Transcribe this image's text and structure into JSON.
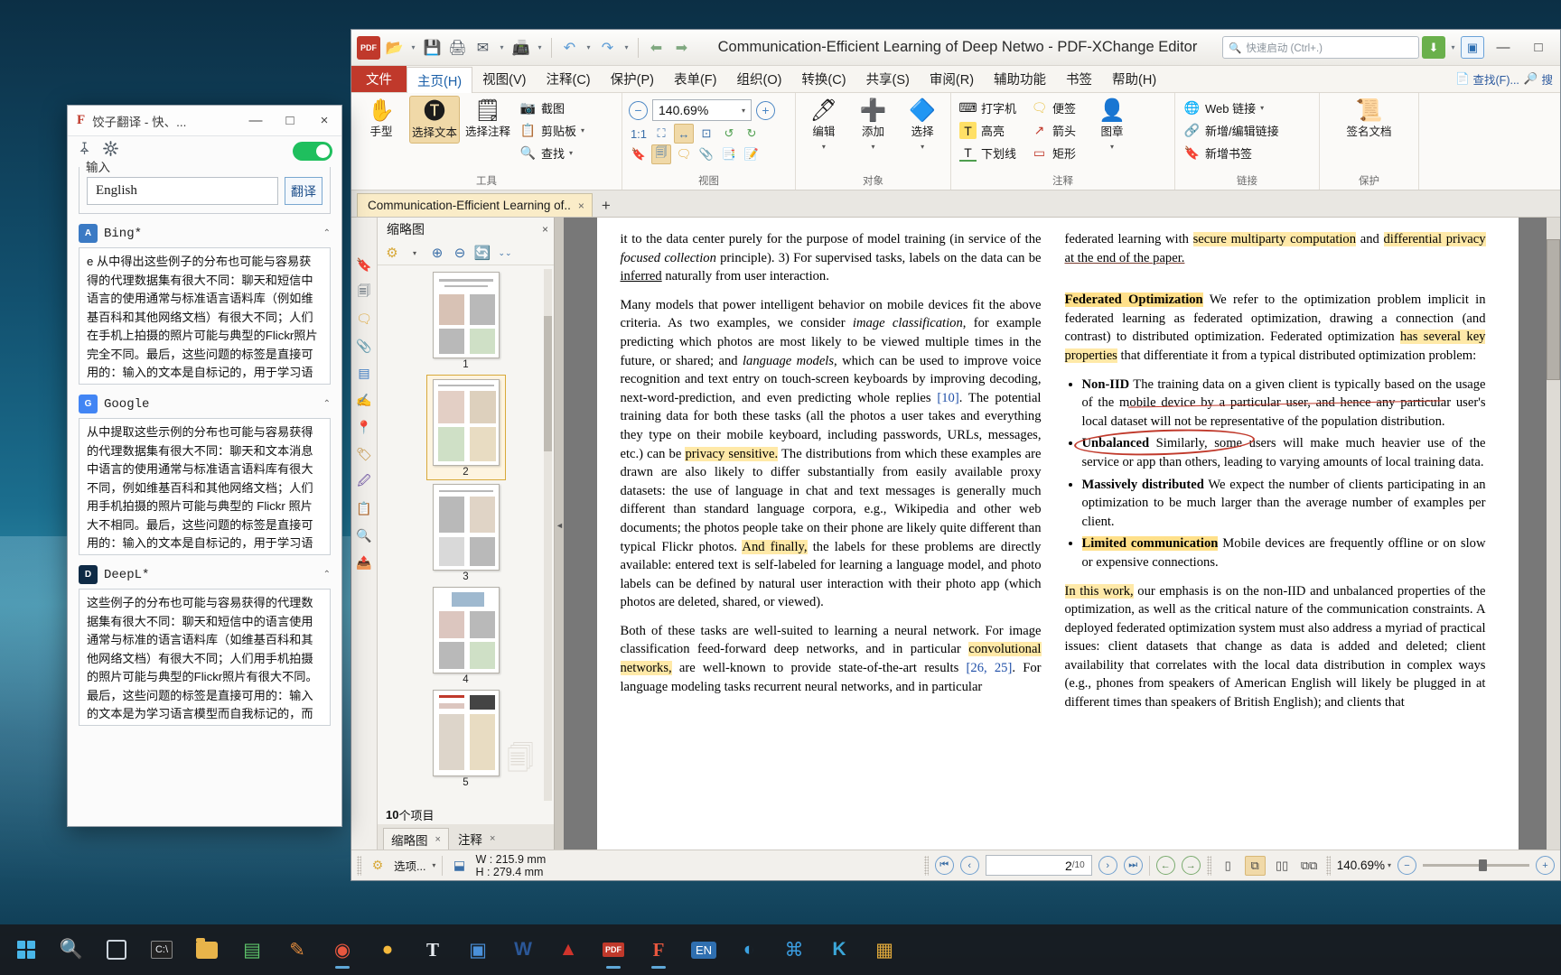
{
  "translator": {
    "logo": "F",
    "title": "饺子翻译 - 快、...",
    "win_minimize": "—",
    "win_maximize": "□",
    "win_close": "×",
    "pin_icon": "📌",
    "gear_icon": "⚙",
    "input_legend": "输入",
    "input_value": "English",
    "translate_button": "翻译",
    "providers": [
      {
        "badge": "A",
        "name": "Bing*",
        "text": "e 从中得出这些例子的分布也可能与容易获得的代理数据集有很大不同：聊天和短信中语言的使用通常与标准语言语料库（例如维基百科和其他网络文档）有很大不同；人们在手机上拍摄的照片可能与典型的Flickr照片完全不同。最后，这些问题的标签是直接可用的：输入的文本是自标记的，用于学习语言模型，照片标签可以通过自然用户与其照片应用程序的交互来定义。"
      },
      {
        "badge": "G",
        "name": "Google",
        "text": "从中提取这些示例的分布也可能与容易获得的代理数据集有很大不同：聊天和文本消息中语言的使用通常与标准语言语料库有很大不同，例如维基百科和其他网络文档；人们用手机拍摄的照片可能与典型的 Flickr 照片大不相同。最后，这些问题的标签是直接可用的：输入的文本是自标记的，用于学习语言模型，照片标签可以通过用户与其照片应用程序的自然交互（哪些照"
      },
      {
        "badge": "D",
        "name": "DeepL*",
        "text": "这些例子的分布也可能与容易获得的代理数据集有很大不同：聊天和短信中的语言使用通常与标准的语言语料库（如维基百科和其他网络文档）有很大不同；人们用手机拍摄的照片可能与典型的Flickr照片有很大不同。最后，这些问题的标签是直接可用的：输入的文本是为学习语言模型而自我标记的，而照片的标签可以通过用户与他们的照片应用程序的自然互动（哪些照"
      }
    ]
  },
  "pdf": {
    "app_title": "Communication-Efficient Learning of Deep Netwo - PDF-XChange Editor",
    "quick_access": {
      "logo_label": "PDF",
      "icons": [
        "open-icon",
        "save-icon",
        "print-icon",
        "email-icon",
        "scan-icon",
        "undo-icon",
        "redo-icon",
        "back-icon",
        "forward-icon"
      ]
    },
    "search_placeholder": "快速启动 (Ctrl+.)",
    "window_buttons": {
      "minimize": "—",
      "maximize": "□",
      "close": "×"
    },
    "menu": {
      "file": "文件",
      "items": [
        {
          "label": "主页(H)",
          "active": true
        },
        {
          "label": "视图(V)",
          "active": false
        },
        {
          "label": "注释(C)",
          "active": false
        },
        {
          "label": "保护(P)",
          "active": false
        },
        {
          "label": "表单(F)",
          "active": false
        },
        {
          "label": "组织(O)",
          "active": false
        },
        {
          "label": "转换(C)",
          "active": false
        },
        {
          "label": "共享(S)",
          "active": false
        },
        {
          "label": "审阅(R)",
          "active": false
        },
        {
          "label": "辅助功能",
          "active": false
        },
        {
          "label": "书签",
          "active": false
        },
        {
          "label": "帮助(H)",
          "active": false
        }
      ],
      "right_items": [
        {
          "label": "查找(F)...",
          "icon": "find-icon"
        },
        {
          "label": "搜",
          "icon": "search-icon"
        }
      ]
    },
    "ribbon": {
      "groups": [
        {
          "name": "工具",
          "big_buttons": [
            {
              "label": "手型",
              "icon": "hand-icon",
              "selected": false
            },
            {
              "label": "选择文本",
              "icon": "select-text-icon",
              "selected": true
            },
            {
              "label": "选择注释",
              "icon": "select-annotation-icon",
              "selected": false
            }
          ],
          "small_buttons": [
            {
              "label": "截图",
              "icon": "snapshot-icon",
              "caret": false
            },
            {
              "label": "剪贴板",
              "icon": "clipboard-icon",
              "caret": true
            },
            {
              "label": "查找",
              "icon": "find-icon",
              "caret": true
            }
          ]
        },
        {
          "name": "视图",
          "zoom_value": "140.69%",
          "zoom_out": "−",
          "zoom_in": "+",
          "icons_row1": [
            "actual-size-icon",
            "fit-page-icon",
            "fit-width-icon",
            "fit-visible-icon",
            "rotate-left-icon",
            "rotate-right-icon"
          ],
          "icons_row2": [
            "bookmark-pane-icon",
            "thumbnail-pane-icon",
            "comments-pane-icon",
            "attachments-pane-icon",
            "content-pane-icon",
            "properties-icon"
          ]
        },
        {
          "name": "对象",
          "big_buttons": [
            {
              "label": "编辑",
              "icon": "edit-content-icon",
              "caret": true
            },
            {
              "label": "添加",
              "icon": "add-content-icon",
              "caret": true
            },
            {
              "label": "选择",
              "icon": "select-object-icon",
              "caret": true
            }
          ]
        },
        {
          "name": "注释",
          "small_buttons": [
            {
              "label": "打字机",
              "icon": "typewriter-icon"
            },
            {
              "label": "便签",
              "icon": "sticky-note-icon"
            },
            {
              "label": "高亮",
              "icon": "highlight-icon"
            },
            {
              "label": "箭头",
              "icon": "arrow-icon"
            },
            {
              "label": "下划线",
              "icon": "underline-icon"
            },
            {
              "label": "矩形",
              "icon": "rectangle-icon"
            }
          ],
          "stamp": {
            "label": "图章",
            "icon": "stamp-icon",
            "caret": true
          }
        },
        {
          "name": "链接",
          "small_buttons": [
            {
              "label": "Web 链接",
              "icon": "web-link-icon",
              "caret": true
            },
            {
              "label": "新增/编辑链接",
              "icon": "edit-link-icon",
              "caret": false
            },
            {
              "label": "新增书签",
              "icon": "add-bookmark-icon",
              "caret": false
            }
          ]
        },
        {
          "name": "保护",
          "big_buttons": [
            {
              "label": "签名文档",
              "icon": "sign-document-icon"
            }
          ]
        }
      ]
    },
    "doc_tab": {
      "label": "Communication-Efficient Learning of..",
      "close": "×",
      "new_tab": "+"
    },
    "thumbnails": {
      "title": "缩略图",
      "collapse": "×",
      "tool_icons": [
        "settings-icon",
        "caret-down-icon",
        "zoom-in-icon",
        "zoom-out-icon",
        "rotate-icon",
        "more-icon"
      ],
      "pages": [
        {
          "number": "1",
          "current": false
        },
        {
          "number": "2",
          "current": true
        },
        {
          "number": "3",
          "current": false
        },
        {
          "number": "4",
          "current": false
        },
        {
          "number": "5",
          "current": false
        }
      ],
      "item_count_bold": "10",
      "item_count_text": " 个项目",
      "tabs": [
        {
          "label": "缩略图",
          "active": true,
          "close": "×"
        },
        {
          "label": "注释",
          "active": false,
          "close": "×"
        }
      ]
    },
    "document": {
      "left_column": {
        "p1": "it to the data center purely for the purpose of model training (in service of the ",
        "p1_ital": "focused collection",
        "p1_b": " principle). 3) For supervised tasks, labels on the data can be ",
        "p1_udl": "inferred",
        "p1_c": " naturally from user interaction.",
        "p2_a": "Many models that power intelligent behavior on mobile devices fit the above criteria. As two examples, we consider ",
        "p2_ital1": "image classification",
        "p2_b": ", for example predicting which photos are most likely to be viewed multiple times in the future, or shared; and ",
        "p2_ital2": "language models",
        "p2_c": ", which can be used to improve voice recognition and text entry on touch-screen keyboards by improving decoding, next-word-prediction, and even predicting whole replies ",
        "p2_ref": "[10]",
        "p2_d": ". The potential training data for both these tasks (all the photos a user takes and everything they type on their mobile keyboard, including passwords, URLs, messages, etc.) can be ",
        "p2_hl": "privacy sensitive.",
        "p2_e": " The distributions from which these examples are drawn are also likely to differ substantially from easily available proxy datasets: the use of language in chat and text messages is generally much different than standard language corpora, e.g., Wikipedia and other web documents; the photos people take on their phone are likely quite different than typical Flickr photos. ",
        "p2_hl2": "And finally,",
        "p2_f": " the labels for these problems are directly available: entered text is self-labeled for learning a language model, and photo labels can be defined by natural user interaction with their photo app (which photos are deleted, shared, or viewed).",
        "p3_a": "Both of these tasks are well-suited to learning a neural network. For image classification feed-forward deep networks, and in particular ",
        "p3_hl": "convolutional networks,",
        "p3_b": " are well-known to provide state-of-the-art results ",
        "p3_ref1": "[26,",
        "p3_ref2": " 25]",
        "p3_c": ". For language modeling tasks recurrent neural networks, and in particular"
      },
      "right_column": {
        "p1_a": "federated learning with ",
        "p1_hl1": "secure multiparty computation",
        "p1_b": " and ",
        "p1_hl2": "differential privacy",
        "p1_udl": " at the end of the paper.",
        "h1": "Federated Optimization",
        "p2_a": " We refer to the optimization problem implicit in federated learning as federated optimization, drawing a connection (and contrast) to distributed optimization. Federated optimization ",
        "p2_hl": "has several key properties",
        "p2_b": " that differentiate it from a typical distributed optimization problem:",
        "bullets": [
          {
            "term": "Non-IID",
            "text": " The training data on a given client is typically based on the usage of the mobile device by a particular user, and hence any particular user's local dataset will not be representative of the population distribution.",
            "annotated": "strikethrough"
          },
          {
            "term": "Unbalanced",
            "text": " Similarly, some users will make much heavier use of the service or app than others, leading to varying amounts of local training data.",
            "annotated": "red-circle"
          },
          {
            "term": "Massively distributed",
            "text": " We expect the number of clients participating in an optimization to be much larger than the average number of examples per client.",
            "annotated": "none"
          },
          {
            "term": "Limited communication",
            "text": " Mobile devices are frequently offline or on slow or expensive connections.",
            "annotated": "highlight"
          }
        ],
        "p3_hl": "In this work,",
        "p3_text": " our emphasis is on the non-IID and unbalanced properties of the optimization, as well as the critical nature of the communication constraints. A deployed federated optimization system must also address a myriad of practical issues: client datasets that change as data is added and deleted; client availability that correlates with the local data distribution in complex ways (e.g., phones from speakers of American English will likely be plugged in at different times than speakers of British English); and clients that"
      }
    },
    "status_bar": {
      "options_label": "选项...",
      "width_label": "W : 215.9 mm",
      "height_label": "H : 279.4 mm",
      "page_current": "2",
      "page_total": "/10",
      "zoom_value": "140.69%",
      "zoom_minus": "−",
      "zoom_plus": "+",
      "nav_first": "⏮",
      "nav_prev": "‹",
      "nav_next": "›",
      "nav_last": "⏭",
      "back": "←",
      "forward": "→",
      "view_modes": [
        "single-page-icon",
        "continuous-icon",
        "two-page-icon",
        "two-page-continuous-icon"
      ]
    }
  },
  "taskbar": {
    "items": [
      {
        "name": "start-button",
        "icon": "windows-logo"
      },
      {
        "name": "search-button",
        "icon": "🔍"
      },
      {
        "name": "task-view-button",
        "icon": "task-view"
      },
      {
        "name": "terminal-app",
        "icon": "C:\\"
      },
      {
        "name": "file-explorer-app",
        "icon": "folder"
      },
      {
        "name": "app-green",
        "icon": "▤"
      },
      {
        "name": "app-orange",
        "icon": "✎"
      },
      {
        "name": "chrome-app",
        "icon": "◉"
      },
      {
        "name": "browser-app",
        "icon": "●"
      },
      {
        "name": "text-app",
        "icon": "T"
      },
      {
        "name": "blue-app",
        "icon": "▣"
      },
      {
        "name": "word-app",
        "icon": "W"
      },
      {
        "name": "acrobat-app",
        "icon": "▲"
      },
      {
        "name": "pdfxchange-app",
        "icon": "PDF"
      },
      {
        "name": "translator-app",
        "icon": "F"
      },
      {
        "name": "ime-indicator",
        "icon": "EN"
      },
      {
        "name": "edge-app",
        "icon": "◐"
      },
      {
        "name": "code-app",
        "icon": "⌘"
      },
      {
        "name": "kodi-app",
        "icon": "K"
      },
      {
        "name": "photo-app",
        "icon": "▦"
      }
    ]
  }
}
